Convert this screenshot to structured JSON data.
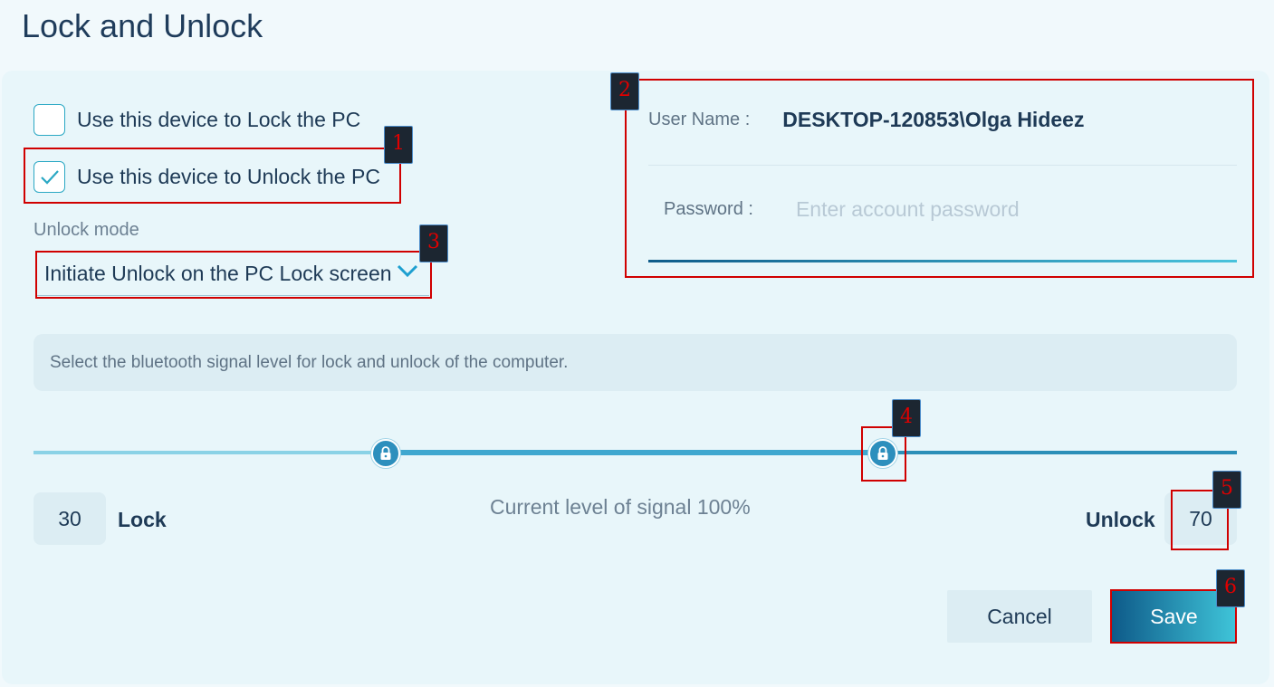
{
  "page": {
    "title": "Lock and Unlock"
  },
  "options": {
    "lock": {
      "label": "Use this device to Lock the PC",
      "checked": false
    },
    "unlock": {
      "label": "Use this device to Unlock the PC",
      "checked": true
    }
  },
  "unlock_mode": {
    "label": "Unlock mode",
    "selected": "Initiate Unlock on the PC Lock screen"
  },
  "credentials": {
    "username_label": "User Name :",
    "username_value": "DESKTOP-120853\\Olga Hideez",
    "password_label": "Password :",
    "password_placeholder": "Enter account password",
    "password_value": ""
  },
  "signal": {
    "instruction": "Select the bluetooth signal level for lock and unlock of the computer.",
    "current_text": "Current level of signal 100%",
    "lock_label": "Lock",
    "lock_value": "30",
    "unlock_label": "Unlock",
    "unlock_value": "70"
  },
  "buttons": {
    "cancel": "Cancel",
    "save": "Save"
  },
  "annotations": [
    "1",
    "2",
    "3",
    "4",
    "5",
    "6"
  ],
  "colors": {
    "accent": "#2ba8c4",
    "annotation_red": "#d00000",
    "save_gradient_start": "#0e5a89",
    "save_gradient_end": "#3fc5d9"
  }
}
